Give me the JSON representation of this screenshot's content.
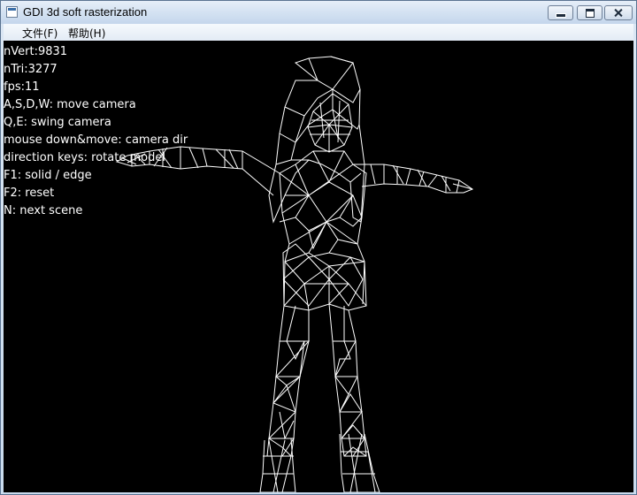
{
  "window": {
    "title": "GDI 3d soft rasterization",
    "controls": [
      "minimize",
      "maximize",
      "close"
    ]
  },
  "menu": {
    "file": "文件(F)",
    "help": "帮助(H)"
  },
  "stats": {
    "nvert": "nVert:9831",
    "ntri": "nTri:3277",
    "fps": "fps:11"
  },
  "help_lines": [
    "A,S,D,W: move camera",
    "Q,E: swing camera",
    "mouse down&move: camera dir",
    "direction keys: rotate model",
    "F1: solid / edge",
    "F2: reset",
    "N: next scene"
  ],
  "scene": {
    "background": "#000000",
    "wire_color": "#ffffff",
    "content": "wireframe-character-model"
  }
}
